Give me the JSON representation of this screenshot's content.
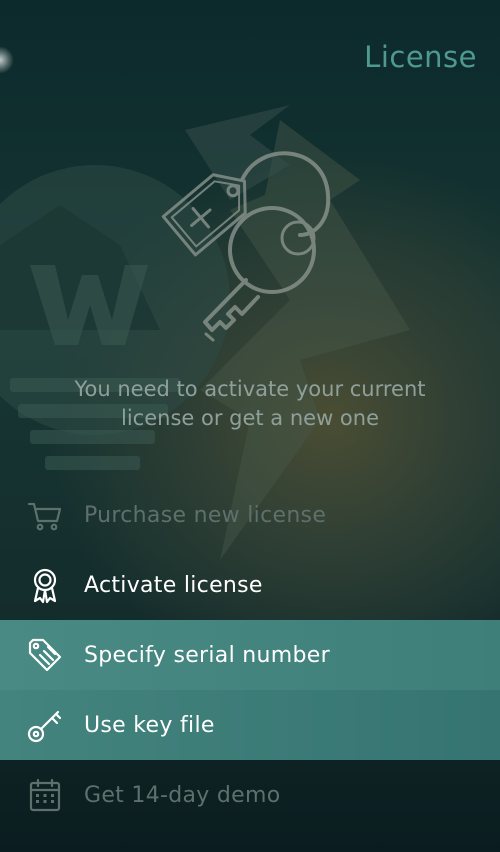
{
  "header": {
    "title": "License",
    "back_icon": "back-glow-icon"
  },
  "hero": {
    "icon": "license-tag-and-key-icon"
  },
  "message": {
    "line1": "You need to activate your current",
    "line2": "license or get a new one"
  },
  "menu": {
    "items": [
      {
        "label": "Purchase new license",
        "icon": "cart-icon",
        "state": "dim"
      },
      {
        "label": "Activate license",
        "icon": "award-ribbon-icon",
        "state": "bright"
      },
      {
        "label": "Specify serial number",
        "icon": "tag-icon",
        "state": "highlighted"
      },
      {
        "label": "Use key file",
        "icon": "key-icon",
        "state": "highlighted"
      },
      {
        "label": "Get 14-day demo",
        "icon": "calendar-icon",
        "state": "dim"
      }
    ]
  },
  "colors": {
    "accent": "#4e9a93",
    "highlight": "#3e7c78",
    "dim_text": "#5d706b",
    "message_text": "#8fa09b"
  }
}
